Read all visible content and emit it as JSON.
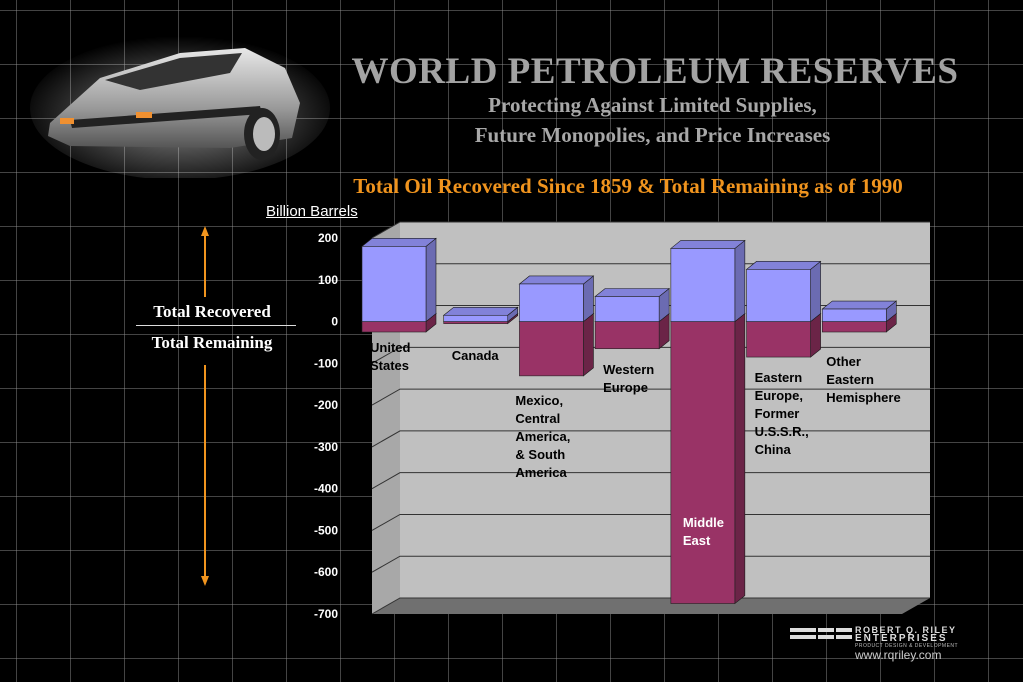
{
  "header": {
    "title": "WORLD PETROLEUM RESERVES",
    "subtitle_line1": "Protecting Against Limited Supplies,",
    "subtitle_line2": "Future Monopolies, and Price Increases"
  },
  "legend": {
    "recovered": "Total Recovered",
    "remaining": "Total Remaining"
  },
  "footer": {
    "logo_line1": "ROBERT Q. RILEY",
    "logo_line2": "ENTERPRISES",
    "logo_line3": "PRODUCT DESIGN & DEVELOPMENT",
    "url": "www.rqriley.com"
  },
  "colors": {
    "recovered": "#9999ff",
    "remaining": "#993366",
    "heading": "#f0941e",
    "plot_bg": "#c0c0c0"
  },
  "chart_data": {
    "type": "bar",
    "title": "Total Oil Recovered Since 1859 & Total Remaining as of 1990",
    "ylabel": "Billion Barrels",
    "xlabel": "",
    "ylim": [
      -700,
      200
    ],
    "yticks": [
      200,
      100,
      0,
      -100,
      -200,
      -300,
      -400,
      -500,
      -600,
      -700
    ],
    "grid": true,
    "categories": [
      [
        "United",
        "States"
      ],
      [
        "Canada"
      ],
      [
        "Mexico,",
        "Central",
        "America,",
        "& South",
        "America"
      ],
      [
        "Western",
        "Europe"
      ],
      [
        "Middle",
        "East"
      ],
      [
        "Eastern",
        "Europe,",
        "Former",
        "U.S.S.R.,",
        "China"
      ],
      [
        "Other",
        "Eastern",
        "Hemisphere"
      ]
    ],
    "series": [
      {
        "name": "Total Recovered",
        "values": [
          180,
          15,
          90,
          60,
          175,
          125,
          30
        ]
      },
      {
        "name": "Total Remaining",
        "values": [
          -25,
          -5,
          -130,
          -65,
          -675,
          -85,
          -25
        ]
      }
    ]
  }
}
